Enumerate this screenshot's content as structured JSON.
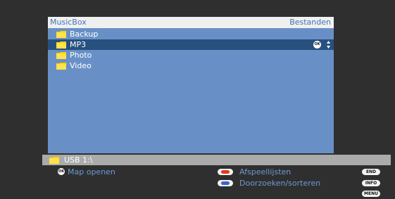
{
  "header": {
    "title": "MusicBox",
    "section": "Bestanden"
  },
  "list": {
    "items": [
      {
        "label": "Backup",
        "icon": "folder-icon",
        "selected": false
      },
      {
        "label": "MP3",
        "icon": "folder-icon",
        "selected": true
      },
      {
        "label": "Photo",
        "icon": "folder-icon",
        "selected": false
      },
      {
        "label": "Video",
        "icon": "folder-icon",
        "selected": false
      }
    ],
    "ok_label": "OK"
  },
  "path": {
    "label": "USB 1:\\"
  },
  "help": {
    "ok_label": "OK",
    "open_folder": "Map openen",
    "playlists": "Afspeellijsten",
    "browse_sort": "Doorzoeken/sorteren",
    "end_label": "END",
    "info_label": "INFO",
    "menu_label": "MENU"
  },
  "colors": {
    "title_bar_bg": "#f0f0f0",
    "title_text": "#3f74b6",
    "panel_bg": "#6990c6",
    "selected_row_bg": "#28507f",
    "path_bar_bg": "#ababab",
    "help_text": "#6d9ad4",
    "folder": "#ffd200",
    "red_key": "#e03a1e",
    "blue_key": "#3a66c8"
  }
}
